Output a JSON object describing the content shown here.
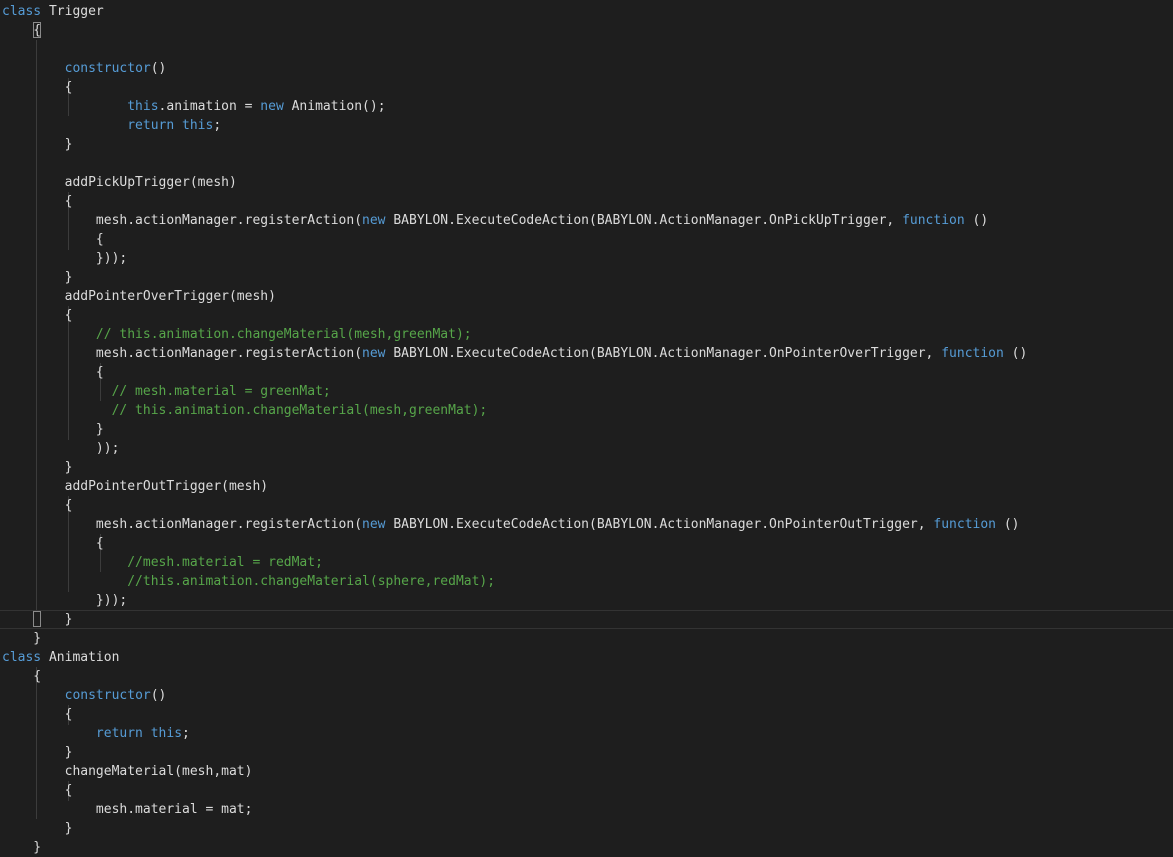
{
  "editor": {
    "colors": {
      "background": "#1e1e1e",
      "keyword": "#569cd6",
      "comment": "#57a64a",
      "text": "#dcdcdc"
    },
    "lines": [
      [
        {
          "t": "class",
          "c": "kw"
        },
        {
          "t": " Trigger",
          "c": "tx"
        }
      ],
      [
        {
          "t": "    {",
          "c": "tx"
        }
      ],
      [],
      [
        {
          "t": "        ",
          "c": "tx"
        },
        {
          "t": "constructor",
          "c": "kw"
        },
        {
          "t": "()",
          "c": "tx"
        }
      ],
      [
        {
          "t": "        {",
          "c": "tx"
        }
      ],
      [
        {
          "t": "                ",
          "c": "tx"
        },
        {
          "t": "this",
          "c": "kw"
        },
        {
          "t": ".animation = ",
          "c": "tx"
        },
        {
          "t": "new",
          "c": "kw"
        },
        {
          "t": " Animation();",
          "c": "tx"
        }
      ],
      [
        {
          "t": "                ",
          "c": "tx"
        },
        {
          "t": "return",
          "c": "kw"
        },
        {
          "t": " ",
          "c": "tx"
        },
        {
          "t": "this",
          "c": "kw"
        },
        {
          "t": ";",
          "c": "tx"
        }
      ],
      [
        {
          "t": "        }",
          "c": "tx"
        }
      ],
      [],
      [
        {
          "t": "        addPickUpTrigger(mesh)",
          "c": "tx"
        }
      ],
      [
        {
          "t": "        {",
          "c": "tx"
        }
      ],
      [
        {
          "t": "            mesh.actionManager.registerAction(",
          "c": "tx"
        },
        {
          "t": "new",
          "c": "kw"
        },
        {
          "t": " BABYLON.ExecuteCodeAction(BABYLON.ActionManager.OnPickUpTrigger, ",
          "c": "tx"
        },
        {
          "t": "function",
          "c": "kw"
        },
        {
          "t": " ()",
          "c": "tx"
        }
      ],
      [
        {
          "t": "            {",
          "c": "tx"
        }
      ],
      [
        {
          "t": "            }));",
          "c": "tx"
        }
      ],
      [
        {
          "t": "        }",
          "c": "tx"
        }
      ],
      [
        {
          "t": "        addPointerOverTrigger(mesh)",
          "c": "tx"
        }
      ],
      [
        {
          "t": "        {",
          "c": "tx"
        }
      ],
      [
        {
          "t": "            ",
          "c": "tx"
        },
        {
          "t": "// this.animation.changeMaterial(mesh,greenMat);",
          "c": "cm"
        }
      ],
      [
        {
          "t": "            mesh.actionManager.registerAction(",
          "c": "tx"
        },
        {
          "t": "new",
          "c": "kw"
        },
        {
          "t": " BABYLON.ExecuteCodeAction(BABYLON.ActionManager.OnPointerOverTrigger, ",
          "c": "tx"
        },
        {
          "t": "function",
          "c": "kw"
        },
        {
          "t": " ()",
          "c": "tx"
        }
      ],
      [
        {
          "t": "            {",
          "c": "tx"
        }
      ],
      [
        {
          "t": "              ",
          "c": "tx"
        },
        {
          "t": "// mesh.material = greenMat;",
          "c": "cm"
        }
      ],
      [
        {
          "t": "              ",
          "c": "tx"
        },
        {
          "t": "// this.animation.changeMaterial(mesh,greenMat);",
          "c": "cm"
        }
      ],
      [
        {
          "t": "            }",
          "c": "tx"
        }
      ],
      [
        {
          "t": "            ));",
          "c": "tx"
        }
      ],
      [
        {
          "t": "        }",
          "c": "tx"
        }
      ],
      [
        {
          "t": "        addPointerOutTrigger(mesh)",
          "c": "tx"
        }
      ],
      [
        {
          "t": "        {",
          "c": "tx"
        }
      ],
      [
        {
          "t": "            mesh.actionManager.registerAction(",
          "c": "tx"
        },
        {
          "t": "new",
          "c": "kw"
        },
        {
          "t": " BABYLON.ExecuteCodeAction(BABYLON.ActionManager.OnPointerOutTrigger, ",
          "c": "tx"
        },
        {
          "t": "function",
          "c": "kw"
        },
        {
          "t": " ()",
          "c": "tx"
        }
      ],
      [
        {
          "t": "            {",
          "c": "tx"
        }
      ],
      [
        {
          "t": "                ",
          "c": "tx"
        },
        {
          "t": "//mesh.material = redMat;",
          "c": "cm"
        }
      ],
      [
        {
          "t": "                ",
          "c": "tx"
        },
        {
          "t": "//this.animation.changeMaterial(sphere,redMat);",
          "c": "cm"
        }
      ],
      [
        {
          "t": "            }));",
          "c": "tx"
        }
      ],
      [
        {
          "t": "        }",
          "c": "tx"
        }
      ],
      [
        {
          "t": "    }",
          "c": "tx"
        }
      ],
      [
        {
          "t": "class",
          "c": "kw"
        },
        {
          "t": " Animation",
          "c": "tx"
        }
      ],
      [
        {
          "t": "    {",
          "c": "tx"
        }
      ],
      [
        {
          "t": "        ",
          "c": "tx"
        },
        {
          "t": "constructor",
          "c": "kw"
        },
        {
          "t": "()",
          "c": "tx"
        }
      ],
      [
        {
          "t": "        {",
          "c": "tx"
        }
      ],
      [
        {
          "t": "            ",
          "c": "tx"
        },
        {
          "t": "return",
          "c": "kw"
        },
        {
          "t": " ",
          "c": "tx"
        },
        {
          "t": "this",
          "c": "kw"
        },
        {
          "t": ";",
          "c": "tx"
        }
      ],
      [
        {
          "t": "        }",
          "c": "tx"
        }
      ],
      [
        {
          "t": "        changeMaterial(mesh,mat)",
          "c": "tx"
        }
      ],
      [
        {
          "t": "        {",
          "c": "tx"
        }
      ],
      [
        {
          "t": "            mesh.material = mat;",
          "c": "tx"
        }
      ],
      [
        {
          "t": "        }",
          "c": "tx"
        }
      ],
      [
        {
          "t": "    }",
          "c": "tx"
        }
      ]
    ]
  }
}
